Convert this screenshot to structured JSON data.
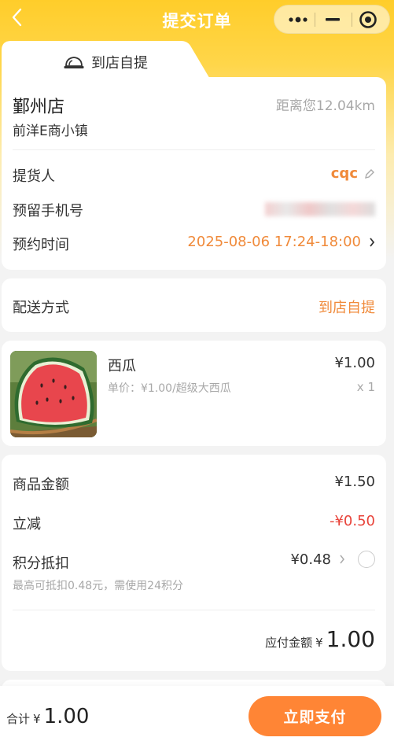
{
  "nav": {
    "title": "提交订单"
  },
  "tab": {
    "label": "到店自提"
  },
  "store": {
    "name": "鄞州店",
    "distance": "距离您12.04km",
    "address": "前洋E商小镇",
    "pickup_label": "提货人",
    "pickup_value": "cqc",
    "phone_label": "预留手机号",
    "time_label": "预约时间",
    "time_value": "2025-08-06 17:24-18:00"
  },
  "delivery": {
    "label": "配送方式",
    "value": "到店自提"
  },
  "product": {
    "name": "西瓜",
    "price": "¥1.00",
    "spec": "单价：¥1.00/超级大西瓜",
    "qty": "x 1"
  },
  "summary": {
    "goods_label": "商品金额",
    "goods_value": "¥1.50",
    "discount_label": "立减",
    "discount_value": "-¥0.50",
    "points_label": "积分抵扣",
    "points_value": "¥0.48",
    "points_hint": "最高可抵扣0.48元，需使用24积分",
    "payable_label": "应付金额",
    "payable_currency": "¥",
    "payable_value": "1.00"
  },
  "footer": {
    "total_label": "合计",
    "total_currency": "¥",
    "total_value": "1.00",
    "pay_button": "立即支付"
  },
  "colors": {
    "accent": "#ff8535",
    "orange_text": "#f08a3a",
    "red": "#e8433a",
    "header": "#ffcd2a"
  }
}
